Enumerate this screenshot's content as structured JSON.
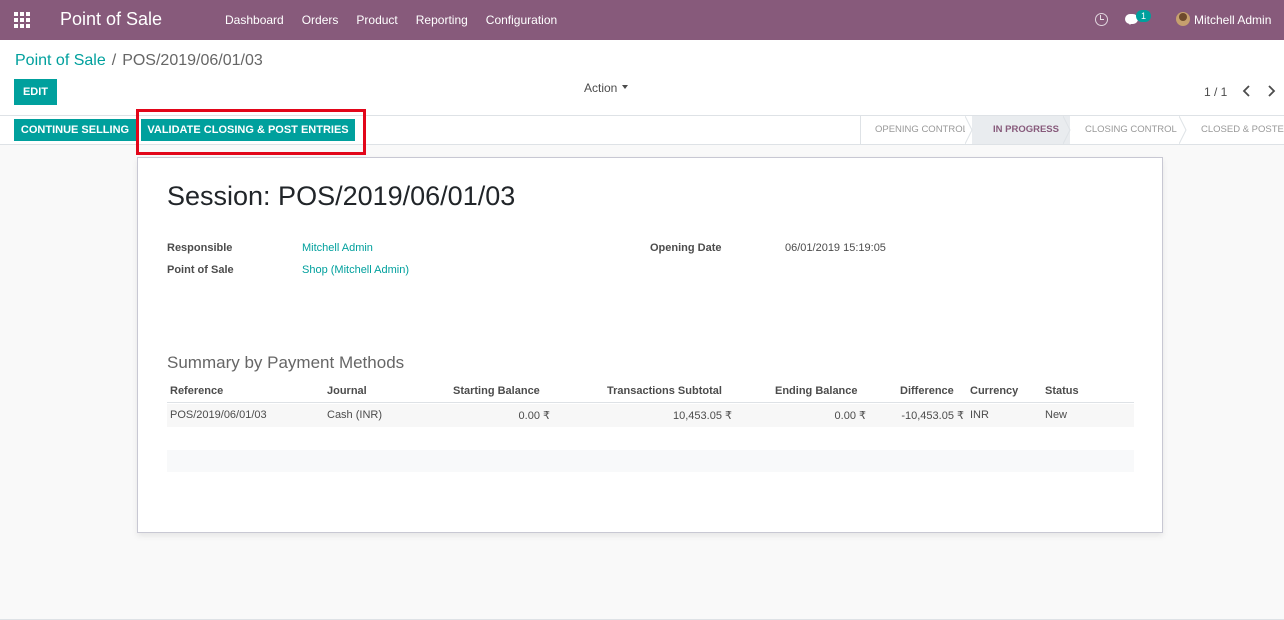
{
  "navbar": {
    "app_title": "Point of Sale",
    "menu": [
      "Dashboard",
      "Orders",
      "Product",
      "Reporting",
      "Configuration"
    ],
    "chat_badge": "1",
    "user_name": "Mitchell Admin",
    "icons": [
      "apps-grid-icon",
      "clock-icon",
      "chat-icon",
      "avatar"
    ]
  },
  "breadcrumb": {
    "parent": "Point of Sale",
    "separator": "/",
    "current": "POS/2019/06/01/03"
  },
  "control_panel": {
    "edit_label": "EDIT",
    "action_label": "Action",
    "pager": "1 / 1"
  },
  "statusbar": {
    "continue_label": "CONTINUE SELLING",
    "validate_label": "VALIDATE CLOSING & POST ENTRIES",
    "stages": [
      "OPENING CONTROL",
      "IN PROGRESS",
      "CLOSING CONTROL",
      "CLOSED & POSTED"
    ],
    "active_stage": "IN PROGRESS"
  },
  "form": {
    "title": "Session: POS/2019/06/01/03",
    "responsible_label": "Responsible",
    "responsible_value": "Mitchell Admin",
    "pos_label": "Point of Sale",
    "pos_value": "Shop (Mitchell Admin)",
    "opening_date_label": "Opening Date",
    "opening_date_value": "06/01/2019 15:19:05",
    "summary_title": "Summary by Payment Methods",
    "table": {
      "headers": [
        "Reference",
        "Journal",
        "Starting Balance",
        "Transactions Subtotal",
        "Ending Balance",
        "Difference",
        "Currency",
        "Status"
      ],
      "rows": [
        {
          "reference": "POS/2019/06/01/03",
          "journal": "Cash (INR)",
          "starting_balance": "0.00 ₹",
          "transactions_subtotal": "10,453.05 ₹",
          "ending_balance": "0.00 ₹",
          "difference": "-10,453.05 ₹",
          "currency": "INR",
          "status": "New"
        }
      ]
    }
  },
  "colors": {
    "brand": "#875a7b",
    "accent": "#00a09d",
    "highlight": "#e2061a"
  }
}
